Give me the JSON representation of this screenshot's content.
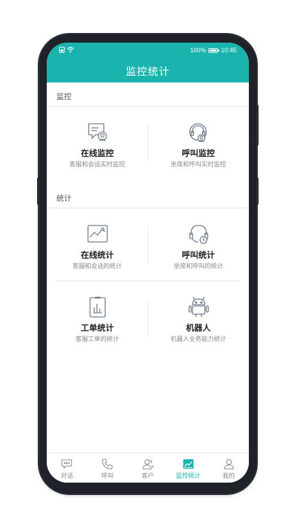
{
  "status": {
    "battery": "100%",
    "time": "10:45"
  },
  "header": {
    "title": "监控统计"
  },
  "sections": {
    "monitor": {
      "label": "监控",
      "cards": [
        {
          "title": "在线监控",
          "subtitle": "客服和会话实时监控",
          "icon": "chat-monitor-icon"
        },
        {
          "title": "呼叫监控",
          "subtitle": "坐席和呼叫实时监控",
          "icon": "headset-monitor-icon"
        }
      ]
    },
    "stats": {
      "label": "统计",
      "cards": [
        {
          "title": "在线统计",
          "subtitle": "客服和会话的统计",
          "icon": "line-chart-icon"
        },
        {
          "title": "呼叫统计",
          "subtitle": "坐席和呼叫的统计",
          "icon": "headset-clock-icon"
        },
        {
          "title": "工单统计",
          "subtitle": "客服工单的统计",
          "icon": "ticket-bar-icon"
        },
        {
          "title": "机器人",
          "subtitle": "机器人业务能力统计",
          "icon": "robot-icon"
        }
      ]
    }
  },
  "tabs": [
    {
      "label": "对话",
      "icon": "chat-bubble-icon",
      "active": false
    },
    {
      "label": "呼叫",
      "icon": "phone-icon",
      "active": false
    },
    {
      "label": "客户",
      "icon": "users-icon",
      "active": false
    },
    {
      "label": "监控统计",
      "icon": "chart-icon",
      "active": true
    },
    {
      "label": "我的",
      "icon": "person-icon",
      "active": false
    }
  ],
  "colors": {
    "accent": "#1ab3ad",
    "icon": "#6f7a8a",
    "text": "#222222",
    "muted": "#8a8a8a"
  }
}
